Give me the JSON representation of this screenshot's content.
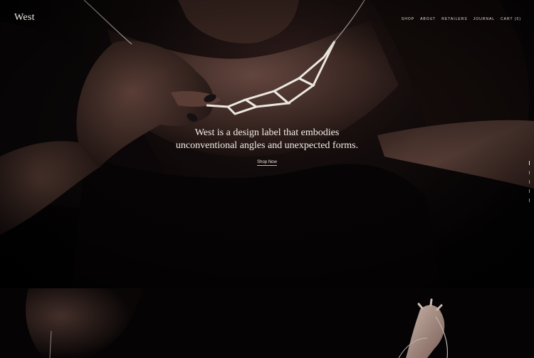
{
  "brand": {
    "logo_text": "West"
  },
  "nav": {
    "items": [
      {
        "label": "SHOP"
      },
      {
        "label": "ABOUT"
      },
      {
        "label": "RETAILERS"
      },
      {
        "label": "JOURNAL"
      },
      {
        "label": "CART (0)"
      }
    ]
  },
  "hero": {
    "tagline_line1": "West is a design label that embodies",
    "tagline_line2": "unconventional angles and unexpected forms.",
    "cta_label": "Shop Now",
    "slide_count": 5,
    "active_slide": 1
  },
  "colors": {
    "background": "#030203",
    "text": "#f3eee8",
    "necklace": "#ece7e1"
  }
}
